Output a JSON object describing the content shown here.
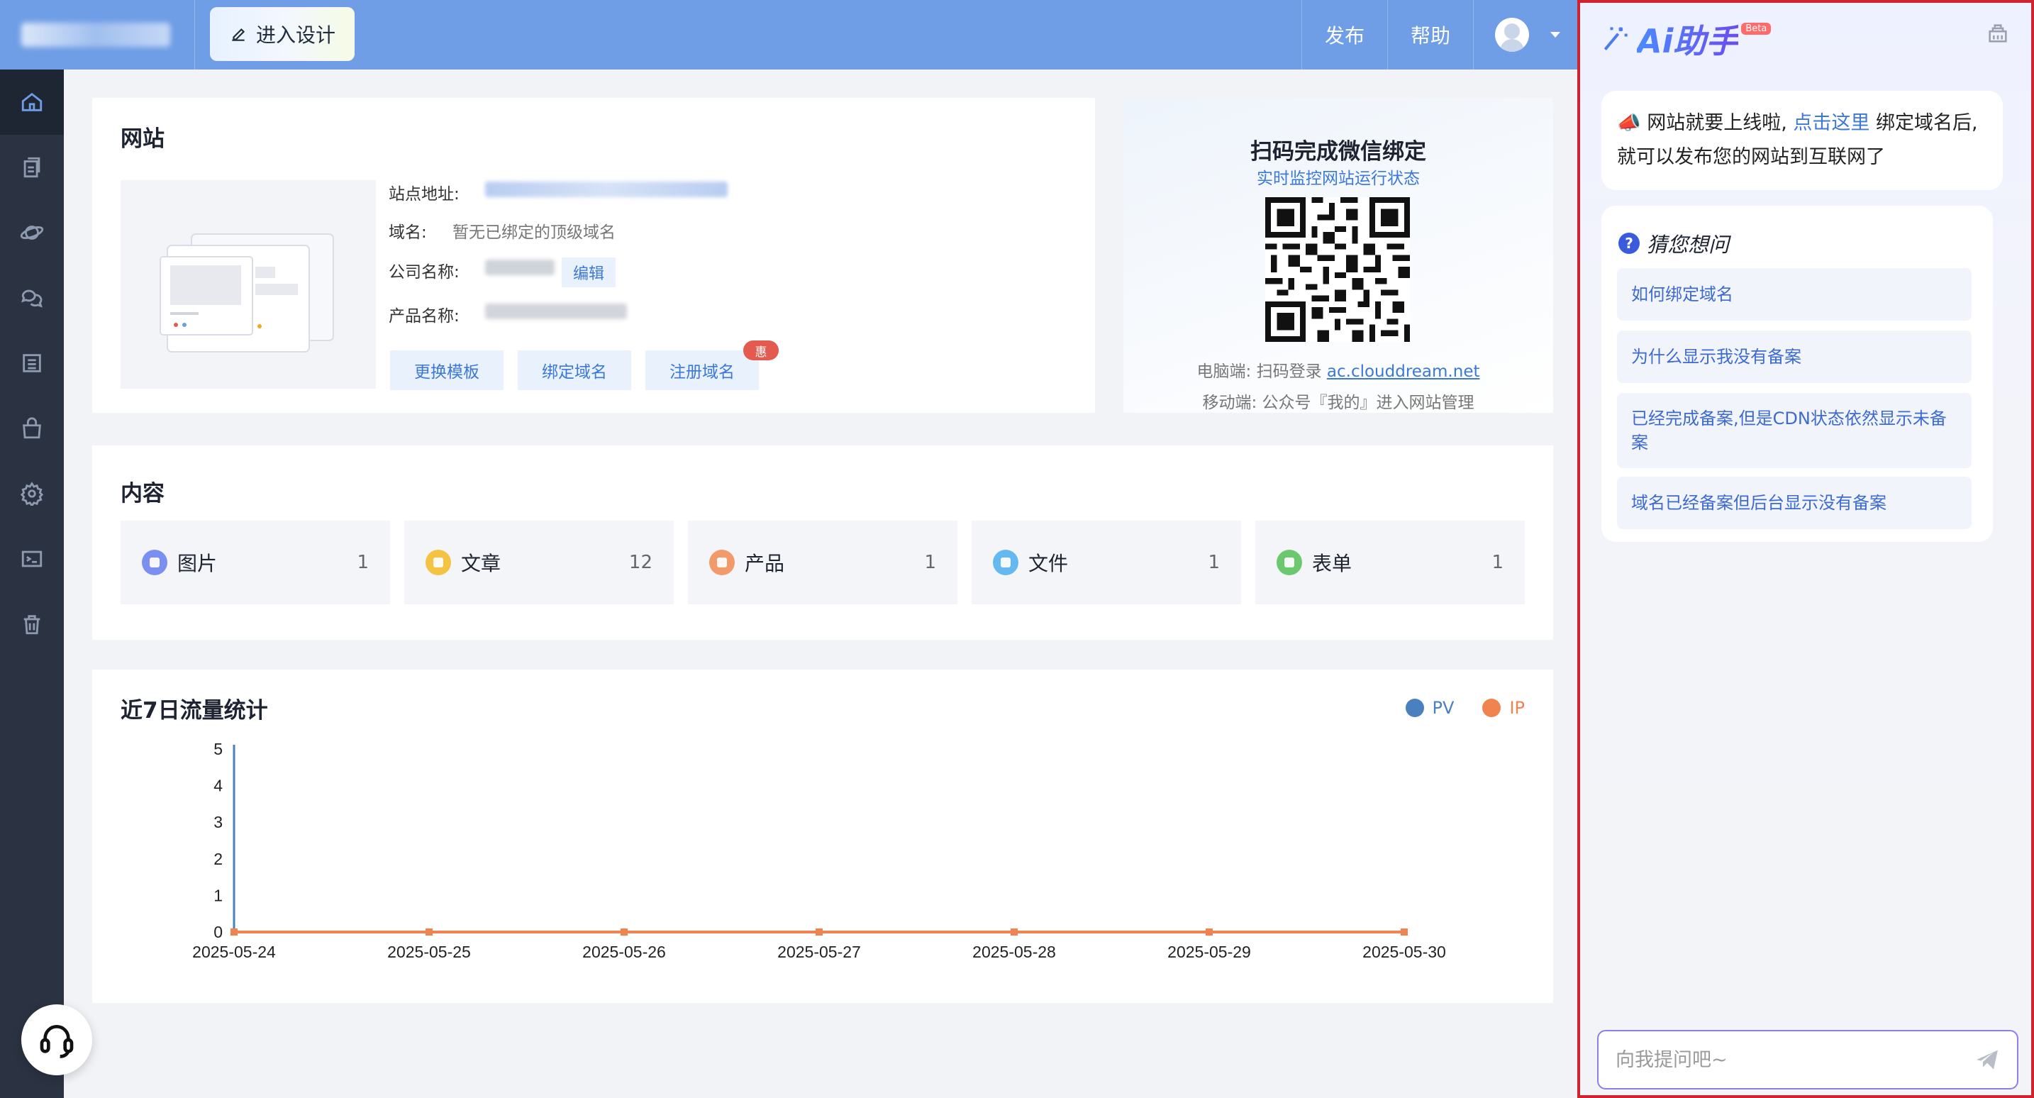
{
  "header": {
    "design_button": "进入设计",
    "publish": "发布",
    "help": "帮助"
  },
  "sidebar": {
    "items": [
      {
        "icon": "home-icon"
      },
      {
        "icon": "pages-icon"
      },
      {
        "icon": "planet-icon"
      },
      {
        "icon": "chat-icon"
      },
      {
        "icon": "list-icon"
      },
      {
        "icon": "shop-icon"
      },
      {
        "icon": "settings-icon"
      },
      {
        "icon": "terminal-icon"
      },
      {
        "icon": "trash-icon"
      }
    ]
  },
  "site": {
    "title": "网站",
    "address_label": "站点地址:",
    "domain_label": "域名:",
    "domain_value": "暂无已绑定的顶级域名",
    "company_label": "公司名称:",
    "edit_label": "编辑",
    "product_label": "产品名称:",
    "buttons": [
      "更换模板",
      "绑定域名",
      "注册域名"
    ],
    "badge": "惠"
  },
  "qr": {
    "title": "扫码完成微信绑定",
    "subtitle": "实时监控网站运行状态",
    "pc_prefix": "电脑端: 扫码登录",
    "pc_link": "ac.clouddream.net",
    "mobile": "移动端: 公众号『我的』进入网站管理"
  },
  "content": {
    "title": "内容",
    "items": [
      {
        "label": "图片",
        "count": "1",
        "color": "#7b8ff0"
      },
      {
        "label": "文章",
        "count": "12",
        "color": "#f5c342"
      },
      {
        "label": "产品",
        "count": "1",
        "color": "#f39a6a"
      },
      {
        "label": "文件",
        "count": "1",
        "color": "#66b8f0"
      },
      {
        "label": "表单",
        "count": "1",
        "color": "#6cc86f"
      }
    ]
  },
  "traffic": {
    "title": "近7日流量统计"
  },
  "chart_data": {
    "type": "line",
    "x": [
      "2025-05-24",
      "2025-05-25",
      "2025-05-26",
      "2025-05-27",
      "2025-05-28",
      "2025-05-29",
      "2025-05-30"
    ],
    "series": [
      {
        "name": "PV",
        "values": [
          0,
          0,
          0,
          0,
          0,
          0,
          0
        ],
        "color": "#4a7fc0"
      },
      {
        "name": "IP",
        "values": [
          0,
          0,
          0,
          0,
          0,
          0,
          0
        ],
        "color": "#f0834f"
      }
    ],
    "ylim": [
      0,
      5
    ],
    "yticks": [
      "0",
      "1",
      "2",
      "3",
      "4",
      "5"
    ],
    "legend": "top-right",
    "grid": false
  },
  "ai": {
    "logo_text": "Ai助手",
    "beta": "Beta",
    "message_prefix": "📣 网站就要上线啦,",
    "message_link": "点击这里",
    "message_suffix": "绑定域名后,就可以发布您的网站到互联网了",
    "guess_title": "猜您想问",
    "questions": [
      "如何绑定域名",
      "为什么显示我没有备案",
      "已经完成备案,但是CDN状态依然显示未备案",
      "域名已经备案但后台显示没有备案"
    ],
    "input_placeholder": "向我提问吧~"
  }
}
